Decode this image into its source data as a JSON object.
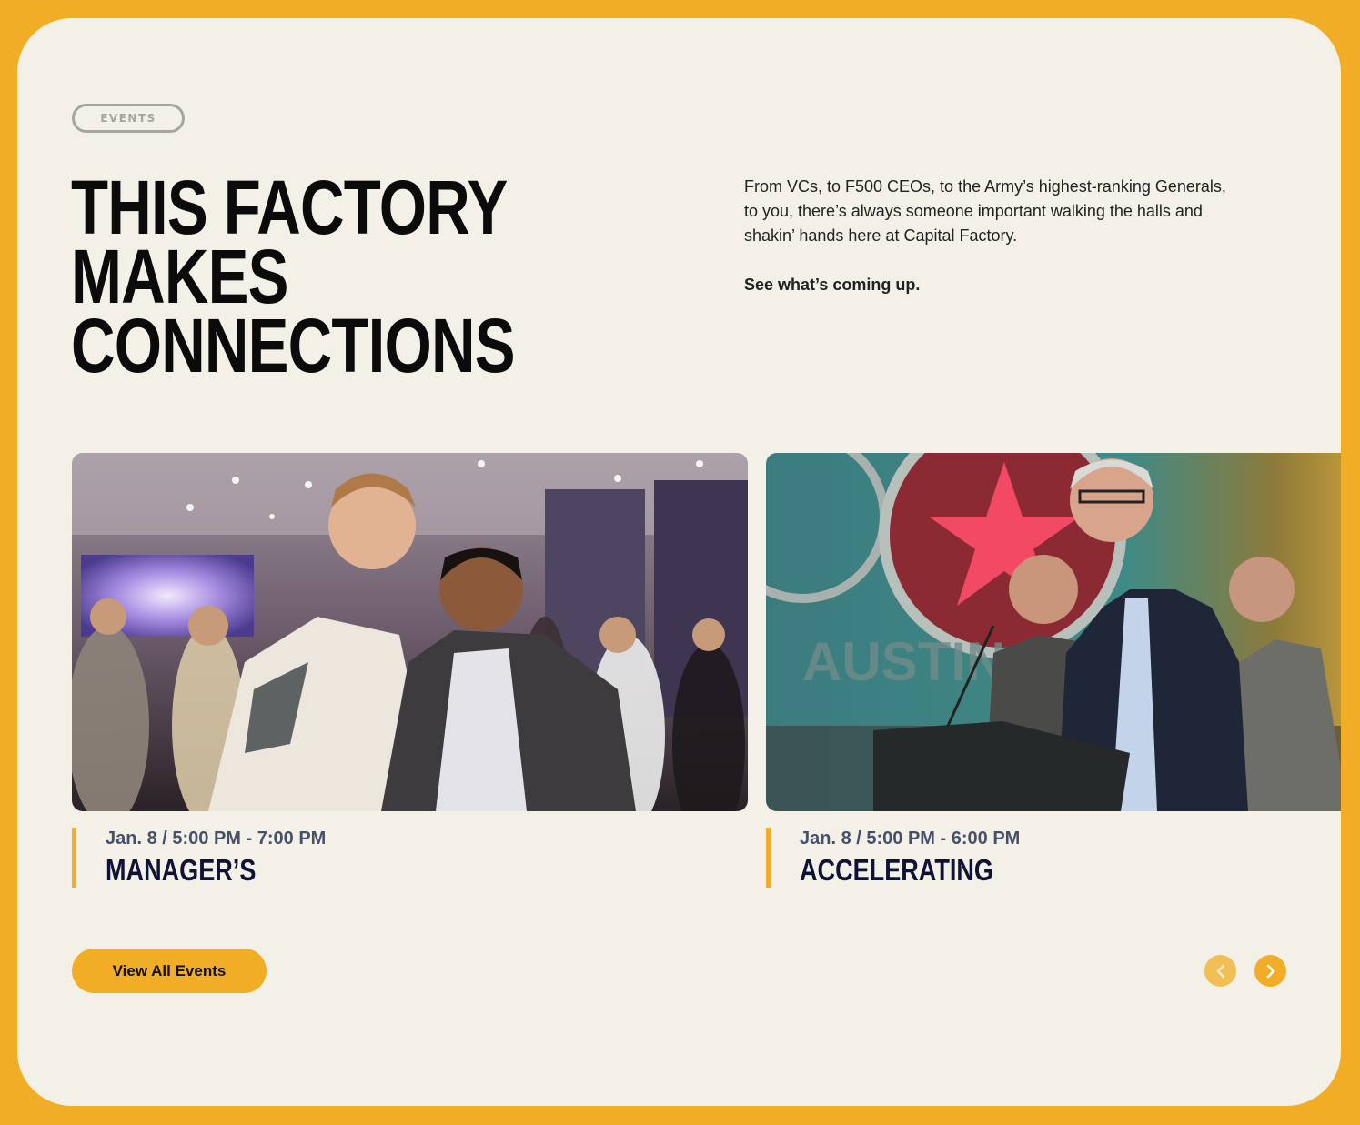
{
  "section": {
    "eyebrow": "EVENTS",
    "headline_lines": [
      "THIS FACTORY",
      "MAKES",
      "CONNECTIONS"
    ],
    "intro": "From VCs, to F500 CEOs, to the Army’s highest-ranking Generals, to you, there’s always someone important walking the halls and shakin’ hands here at Capital Factory.",
    "intro_cta": "See what’s coming up."
  },
  "events": [
    {
      "date": "Jan. 8 / 5:00 PM - 7:00 PM",
      "title": "MANAGER’S"
    },
    {
      "date": "Jan. 8 / 5:00 PM - 6:00 PM",
      "title": "ACCELERATING"
    }
  ],
  "actions": {
    "view_all": "View All Events",
    "prev_icon": "chevron-left-icon",
    "next_icon": "chevron-right-icon"
  },
  "colors": {
    "accent": "#F2AD26",
    "panel": "#F3F1E7",
    "headline": "#0B0B0B",
    "event_title": "#0E1234"
  }
}
